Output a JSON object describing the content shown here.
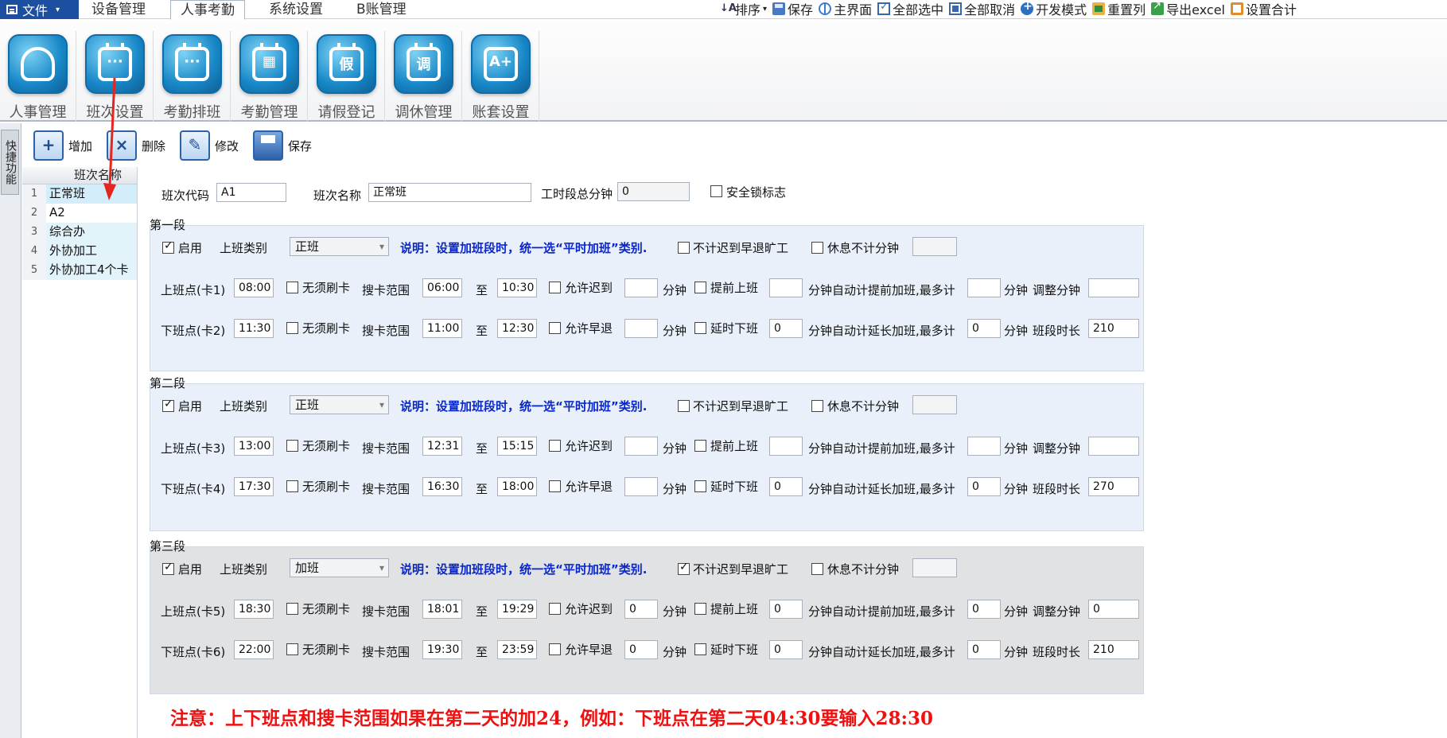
{
  "menubar": {
    "file": "文件",
    "tabs": [
      "设备管理",
      "人事考勤",
      "系统设置",
      "B账管理"
    ],
    "right_tools": [
      "排序",
      "保存",
      "主界面",
      "全部选中",
      "全部取消",
      "开发模式",
      "重置列",
      "导出excel",
      "设置合计"
    ]
  },
  "ribbon": {
    "buttons": [
      "人事管理",
      "班次设置",
      "考勤排班",
      "考勤管理",
      "请假登记",
      "调休管理",
      "账套设置"
    ],
    "glyphs": [
      "person-icon",
      "clock-icon",
      "calendar-icon",
      "calendar-grid-icon",
      "假",
      "调",
      "A+"
    ]
  },
  "side_tab": "快捷功能",
  "actions": {
    "add": "增加",
    "delete": "删除",
    "edit": "修改",
    "save": "保存"
  },
  "shift_list": {
    "header": "班次名称",
    "rows": [
      {
        "num": "1",
        "name": "正常班"
      },
      {
        "num": "2",
        "name": "A2"
      },
      {
        "num": "3",
        "name": "综合办"
      },
      {
        "num": "4",
        "name": "外协加工"
      },
      {
        "num": "5",
        "name": "外协加工4个卡"
      }
    ]
  },
  "header": {
    "code_label": "班次代码",
    "code": "A1",
    "name_label": "班次名称",
    "name": "正常班",
    "total_label": "工时段总分钟",
    "total": "0",
    "lock_label": "安全锁标志"
  },
  "labels": {
    "enable": "启用",
    "shift_type": "上班类别",
    "note": "说明：设置加班段时，统一选“平时加班”类别.",
    "no_late_early_absent": "不计迟到早退旷工",
    "rest_no_minutes": "休息不计分钟",
    "no_swipe": "无须刷卡",
    "range": "搜卡范围",
    "to": "至",
    "allow_late": "允许迟到",
    "allow_early": "允许早退",
    "minutes": "分钟",
    "early_start": "提前上班",
    "delay_end": "延时下班",
    "auto_early_ot": "分钟自动计提前加班,最多计",
    "auto_late_ot": "分钟自动计延长加班,最多计",
    "adjust_min": "调整分钟",
    "segment_len": "班段时长"
  },
  "sections": [
    {
      "title": "第一段",
      "enabled": true,
      "type": "正班",
      "no_count": false,
      "in": {
        "label": "上班点(卡1)",
        "time": "08:00",
        "from": "06:00",
        "to": "10:30",
        "allow": "",
        "early": "",
        "max": "",
        "adjust": ""
      },
      "out": {
        "label": "下班点(卡2)",
        "time": "11:30",
        "from": "11:00",
        "to": "12:30",
        "allow": "",
        "delay": "0",
        "max": "0",
        "length": "210"
      }
    },
    {
      "title": "第二段",
      "enabled": true,
      "type": "正班",
      "no_count": false,
      "in": {
        "label": "上班点(卡3)",
        "time": "13:00",
        "from": "12:31",
        "to": "15:15",
        "allow": "",
        "early": "",
        "max": "",
        "adjust": ""
      },
      "out": {
        "label": "下班点(卡4)",
        "time": "17:30",
        "from": "16:30",
        "to": "18:00",
        "allow": "",
        "delay": "0",
        "max": "0",
        "length": "270"
      }
    },
    {
      "title": "第三段",
      "enabled": true,
      "type": "加班",
      "no_count": true,
      "in": {
        "label": "上班点(卡5)",
        "time": "18:30",
        "from": "18:01",
        "to": "19:29",
        "allow": "0",
        "early": "0",
        "max": "0",
        "adjust": "0"
      },
      "out": {
        "label": "下班点(卡6)",
        "time": "22:00",
        "from": "19:30",
        "to": "23:59",
        "allow": "0",
        "delay": "0",
        "max": "0",
        "length": "210"
      }
    }
  ],
  "warning": "注意：上下班点和搜卡范围如果在第二天的加24，例如：下班点在第二天04:30要输入28:30",
  "colors": {
    "accent": "#1d4fa0",
    "section_bg_blue": "#e9f0f9",
    "section_bg_gray": "#e1e2e4",
    "note_blue": "#0a27c9",
    "warning_red": "#e11111"
  }
}
